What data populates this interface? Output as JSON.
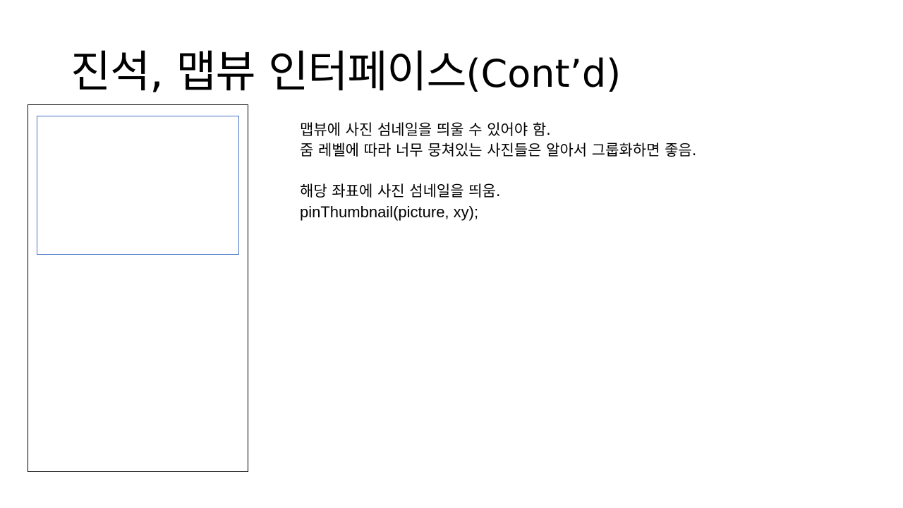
{
  "slide": {
    "title": "진석, 맵뷰 인터페이스",
    "title_suffix": "(Cont’d)"
  },
  "body": {
    "lines": [
      "맵뷰에 사진 섬네일을 띄울 수 있어야 함.",
      "줌 레벨에 따라 너무 뭉쳐있는 사진들은 알아서 그룹화하면 좋음.",
      "",
      "해당 좌표에 사진 섬네일을 띄움.",
      "pinThumbnail(picture, xy);"
    ]
  },
  "colors": {
    "frame_border": "#000000",
    "map_border": "#4472c4"
  }
}
